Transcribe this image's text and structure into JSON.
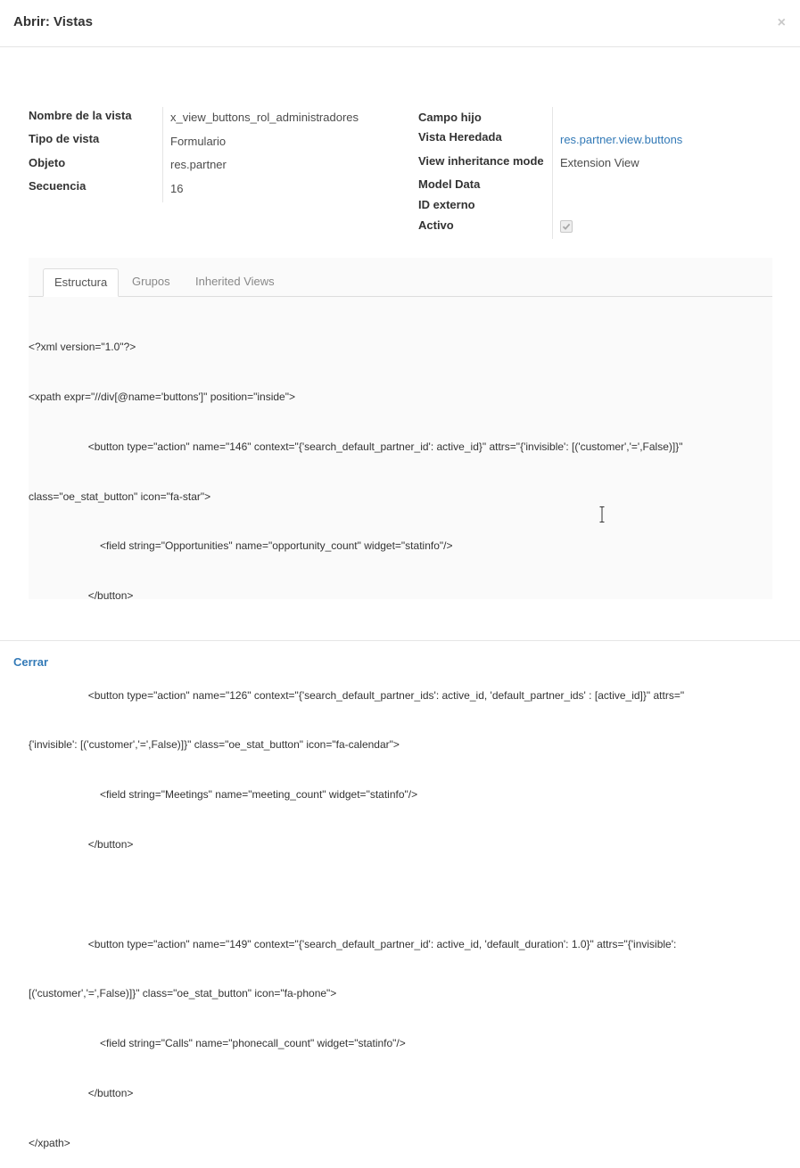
{
  "dialog": {
    "title": "Abrir: Vistas",
    "close_glyph": "×"
  },
  "left_fields": [
    {
      "label": "Nombre de la vista",
      "value": "x_view_buttons_rol_administradores"
    },
    {
      "label": "Tipo de vista",
      "value": "Formulario"
    },
    {
      "label": "Objeto",
      "value": "res.partner"
    },
    {
      "label": "Secuencia",
      "value": "16"
    }
  ],
  "right_fields": [
    {
      "label": "Campo hijo",
      "value": ""
    },
    {
      "label": "Vista Heredada",
      "value": "res.partner.view.buttons"
    },
    {
      "label": "View inheritance mode",
      "value": "Extension View"
    },
    {
      "label": "Model Data",
      "value": ""
    },
    {
      "label": "ID externo",
      "value": ""
    },
    {
      "label": "Activo",
      "value": ""
    }
  ],
  "active_checked": true,
  "tabs": [
    {
      "label": "Estructura",
      "active": true
    },
    {
      "label": "Grupos",
      "active": false
    },
    {
      "label": "Inherited Views",
      "active": false
    }
  ],
  "code_lines": [
    "<?xml version=\"1.0\"?>",
    "<xpath expr=\"//div[@name='buttons']\" position=\"inside\">",
    "                    <button type=\"action\" name=\"146\" context=\"{'search_default_partner_id': active_id}\" attrs=\"{'invisible': [('customer','=',False)]}\"",
    "class=\"oe_stat_button\" icon=\"fa-star\">",
    "                        <field string=\"Opportunities\" name=\"opportunity_count\" widget=\"statinfo\"/>",
    "                    </button>",
    "",
    "                    <button type=\"action\" name=\"126\" context=\"{'search_default_partner_ids': active_id, 'default_partner_ids' : [active_id]}\" attrs=\"",
    "{'invisible': [('customer','=',False)]}\" class=\"oe_stat_button\" icon=\"fa-calendar\">",
    "                        <field string=\"Meetings\" name=\"meeting_count\" widget=\"statinfo\"/>",
    "                    </button>",
    "",
    "                    <button type=\"action\" name=\"149\" context=\"{'search_default_partner_id': active_id, 'default_duration': 1.0}\" attrs=\"{'invisible':",
    "[('customer','=',False)]}\" class=\"oe_stat_button\" icon=\"fa-phone\">",
    "                        <field string=\"Calls\" name=\"phonecall_count\" widget=\"statinfo\"/>",
    "                    </button>",
    "</xpath>"
  ],
  "footer": {
    "close_label": "Cerrar"
  },
  "colors": {
    "link": "#337ab7",
    "label": "#333333",
    "text": "#4c4c4c"
  }
}
